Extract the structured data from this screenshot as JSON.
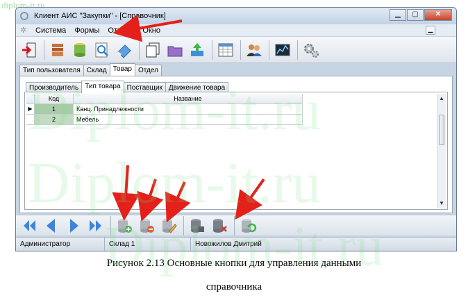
{
  "watermark": {
    "top_text": "diplom-it.ru",
    "big_1": "Diplom-it.ru",
    "big_2": "Diplom-it.ru",
    "big_3": "Diplom-it.ru"
  },
  "window": {
    "title": "Клиент АИС \"Закупки\" - [Справочник]",
    "min_label": "▁",
    "max_label": "▢",
    "close_label": "✕"
  },
  "menubar": {
    "items": [
      "Система",
      "Формы",
      "Отчеты",
      "Окно"
    ],
    "mdi_min_label": "▁"
  },
  "toolbar": {
    "icons": [
      "exit-icon",
      "books-icon",
      "database-icon",
      "search-icon",
      "eraser-icon",
      "copy-icon",
      "folder-open-icon",
      "upload-icon",
      "calendar-grid-icon",
      "users-icon",
      "chart-icon",
      "gears-icon"
    ]
  },
  "outer_tabs": [
    "Тип пользователя",
    "Склад",
    "Товар",
    "Отдел"
  ],
  "outer_active": 2,
  "inner_tabs": [
    "Производитель",
    "Тип товара",
    "Поставщик",
    "Движение товара"
  ],
  "inner_active": 1,
  "grid": {
    "indicator_symbol": "▶",
    "headers": {
      "code": "Код",
      "name": "Название"
    },
    "rows": [
      {
        "code": "1",
        "name": "Канц. Принадлежности"
      },
      {
        "code": "2",
        "name": "Мебель"
      }
    ]
  },
  "navbar": {
    "icons": [
      "first-icon",
      "prev-icon",
      "next-icon",
      "last-icon",
      "add-record-icon",
      "delete-record-icon",
      "edit-record-icon",
      "save-icon",
      "cancel-icon",
      "refresh-icon"
    ]
  },
  "statusbar": {
    "user": "Администратор",
    "warehouse": "Склад 1",
    "person": "Новожилов Дмитрий"
  },
  "caption": {
    "line1": "Рисунок 2.13 Основные кнопки для управления данными",
    "line2": "справочника"
  },
  "colors": {
    "accent_arrow": "#e3211a",
    "window_frame": "#c6d4e3",
    "watermark": "#78dc82"
  }
}
